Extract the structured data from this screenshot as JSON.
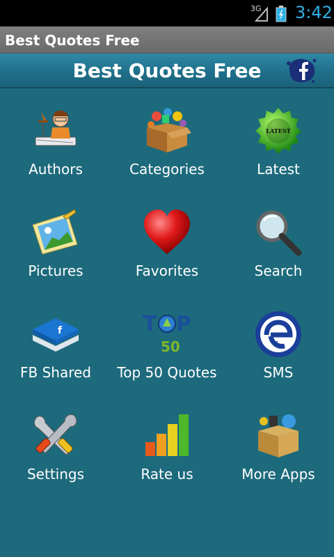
{
  "status_bar": {
    "network": "3G",
    "time": "3:42"
  },
  "app_title": "Best Quotes Free",
  "header": {
    "title": "Best Quotes Free",
    "fb_icon": "facebook-icon"
  },
  "menu": [
    {
      "label": "Authors",
      "icon": "author-icon"
    },
    {
      "label": "Categories",
      "icon": "categories-box-icon"
    },
    {
      "label": "Latest",
      "icon": "latest-icon"
    },
    {
      "label": "Pictures",
      "icon": "pictures-icon"
    },
    {
      "label": "Favorites",
      "icon": "heart-icon"
    },
    {
      "label": "Search",
      "icon": "magnifier-icon"
    },
    {
      "label": "FB Shared",
      "icon": "facebook-shared-icon"
    },
    {
      "label": "Top 50 Quotes",
      "icon": "top50-icon"
    },
    {
      "label": "SMS",
      "icon": "sms-icon"
    },
    {
      "label": "Settings",
      "icon": "tools-icon"
    },
    {
      "label": "Rate us",
      "icon": "bar-chart-icon"
    },
    {
      "label": "More Apps",
      "icon": "apps-box-icon"
    }
  ],
  "colors": {
    "background": "#1d6a7c",
    "header": "#1f6f8a",
    "titlebar": "#727272",
    "clock": "#2fb2e8"
  }
}
